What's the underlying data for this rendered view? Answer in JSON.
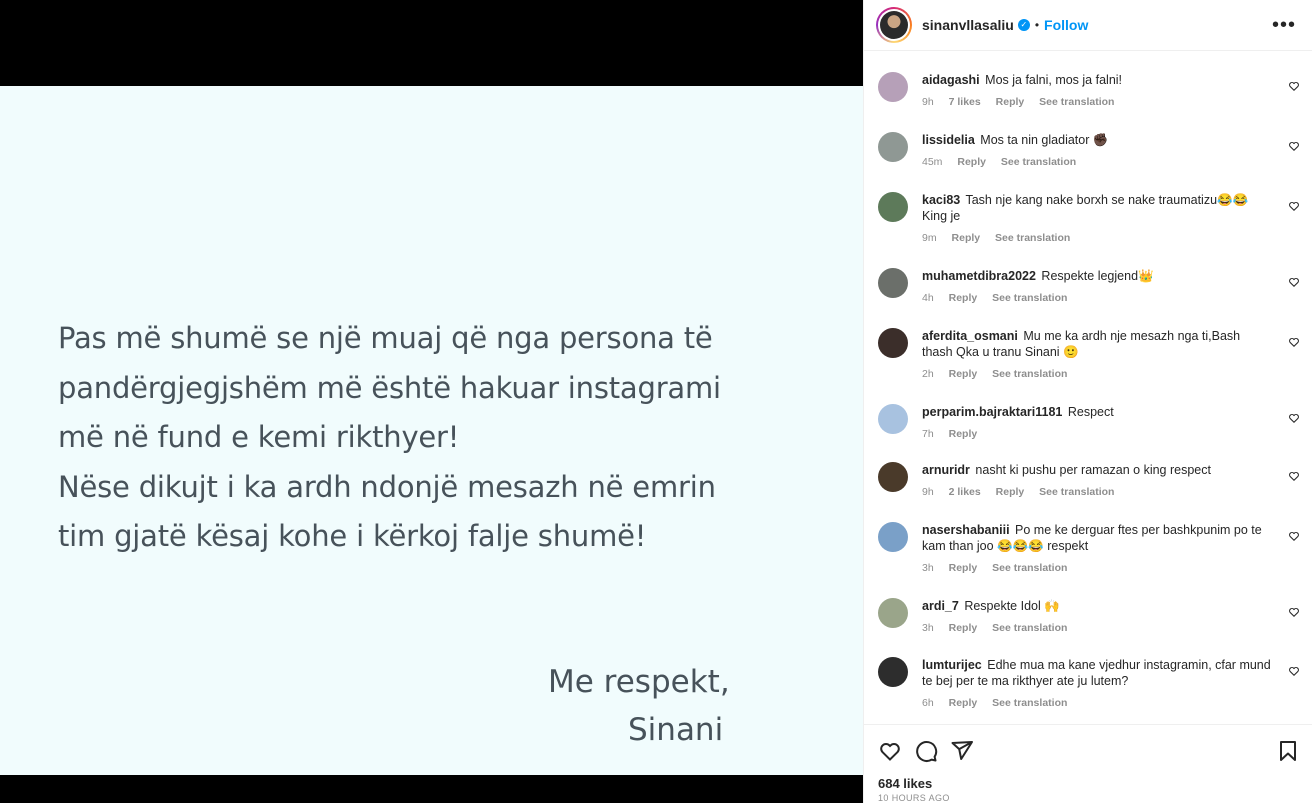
{
  "post": {
    "lines": [
      "Pas më shumë se një muaj që nga persona të",
      "pandërgjegjshëm më është hakuar instagrami",
      "më në fund e kemi rikthyer!",
      "Nëse dikujt i ka ardh ndonjë mesazh në emrin",
      "tim gjatë kësaj kohe i kërkoj falje shumë!"
    ],
    "signoff_1": "Me respekt,",
    "signoff_2": "Sinani"
  },
  "header": {
    "username": "sinanvllasaliu",
    "verified_icon": "verified-badge-icon",
    "separator": "•",
    "follow_label": "Follow",
    "more_icon": "more-options-icon",
    "more_label": "•••"
  },
  "comments": [
    {
      "user": "aidagashi",
      "text": "Mos ja falni, mos ja falni!",
      "time": "9h",
      "likes": "7 likes",
      "reply": "Reply",
      "translate": "See translation",
      "avatar_color": "#b6a0b8"
    },
    {
      "user": "lissidelia",
      "text": "Mos ta nin gladiator ✊🏿",
      "time": "45m",
      "likes": "",
      "reply": "Reply",
      "translate": "See translation",
      "avatar_color": "#8f9894"
    },
    {
      "user": "kaci83",
      "text": "Tash nje kang nake borxh se nake traumatizu😂😂 King je",
      "time": "9m",
      "likes": "",
      "reply": "Reply",
      "translate": "See translation",
      "avatar_color": "#5d7a5a"
    },
    {
      "user": "muhametdibra2022",
      "text": "Respekte legjend👑",
      "time": "4h",
      "likes": "",
      "reply": "Reply",
      "translate": "See translation",
      "avatar_color": "#6b6f6a"
    },
    {
      "user": "aferdita_osmani",
      "text": "Mu me ka ardh nje mesazh nga ti,Bash thash Qka u tranu Sinani 🙂",
      "time": "2h",
      "likes": "",
      "reply": "Reply",
      "translate": "See translation",
      "avatar_color": "#3b2e2a"
    },
    {
      "user": "perparim.bajraktari1181",
      "text": "Respect",
      "time": "7h",
      "likes": "",
      "reply": "Reply",
      "translate": "",
      "avatar_color": "#a8c2e0"
    },
    {
      "user": "arnuridr",
      "text": "nasht ki pushu per ramazan o king respect",
      "time": "9h",
      "likes": "2 likes",
      "reply": "Reply",
      "translate": "See translation",
      "avatar_color": "#4a3a2a"
    },
    {
      "user": "nasershabaniii",
      "text": "Po me ke derguar ftes per bashkpunim po te kam than joo 😂😂😂 respekt",
      "time": "3h",
      "likes": "",
      "reply": "Reply",
      "translate": "See translation",
      "avatar_color": "#7aa0c8"
    },
    {
      "user": "ardi_7",
      "text": "Respekte Idol 🙌",
      "time": "3h",
      "likes": "",
      "reply": "Reply",
      "translate": "See translation",
      "avatar_color": "#9aa58a"
    },
    {
      "user": "lumturijec",
      "text": "Edhe mua ma kane vjedhur instagramin, cfar mund te bej per te ma rikthyer ate ju lutem?",
      "time": "6h",
      "likes": "",
      "reply": "Reply",
      "translate": "See translation",
      "avatar_color": "#2d2d2d"
    }
  ],
  "actions": {
    "like_icon": "heart-icon",
    "comment_icon": "comment-icon",
    "share_icon": "share-icon",
    "save_icon": "bookmark-icon",
    "likes_text": "684 likes",
    "time_text": "10 HOURS AGO"
  }
}
